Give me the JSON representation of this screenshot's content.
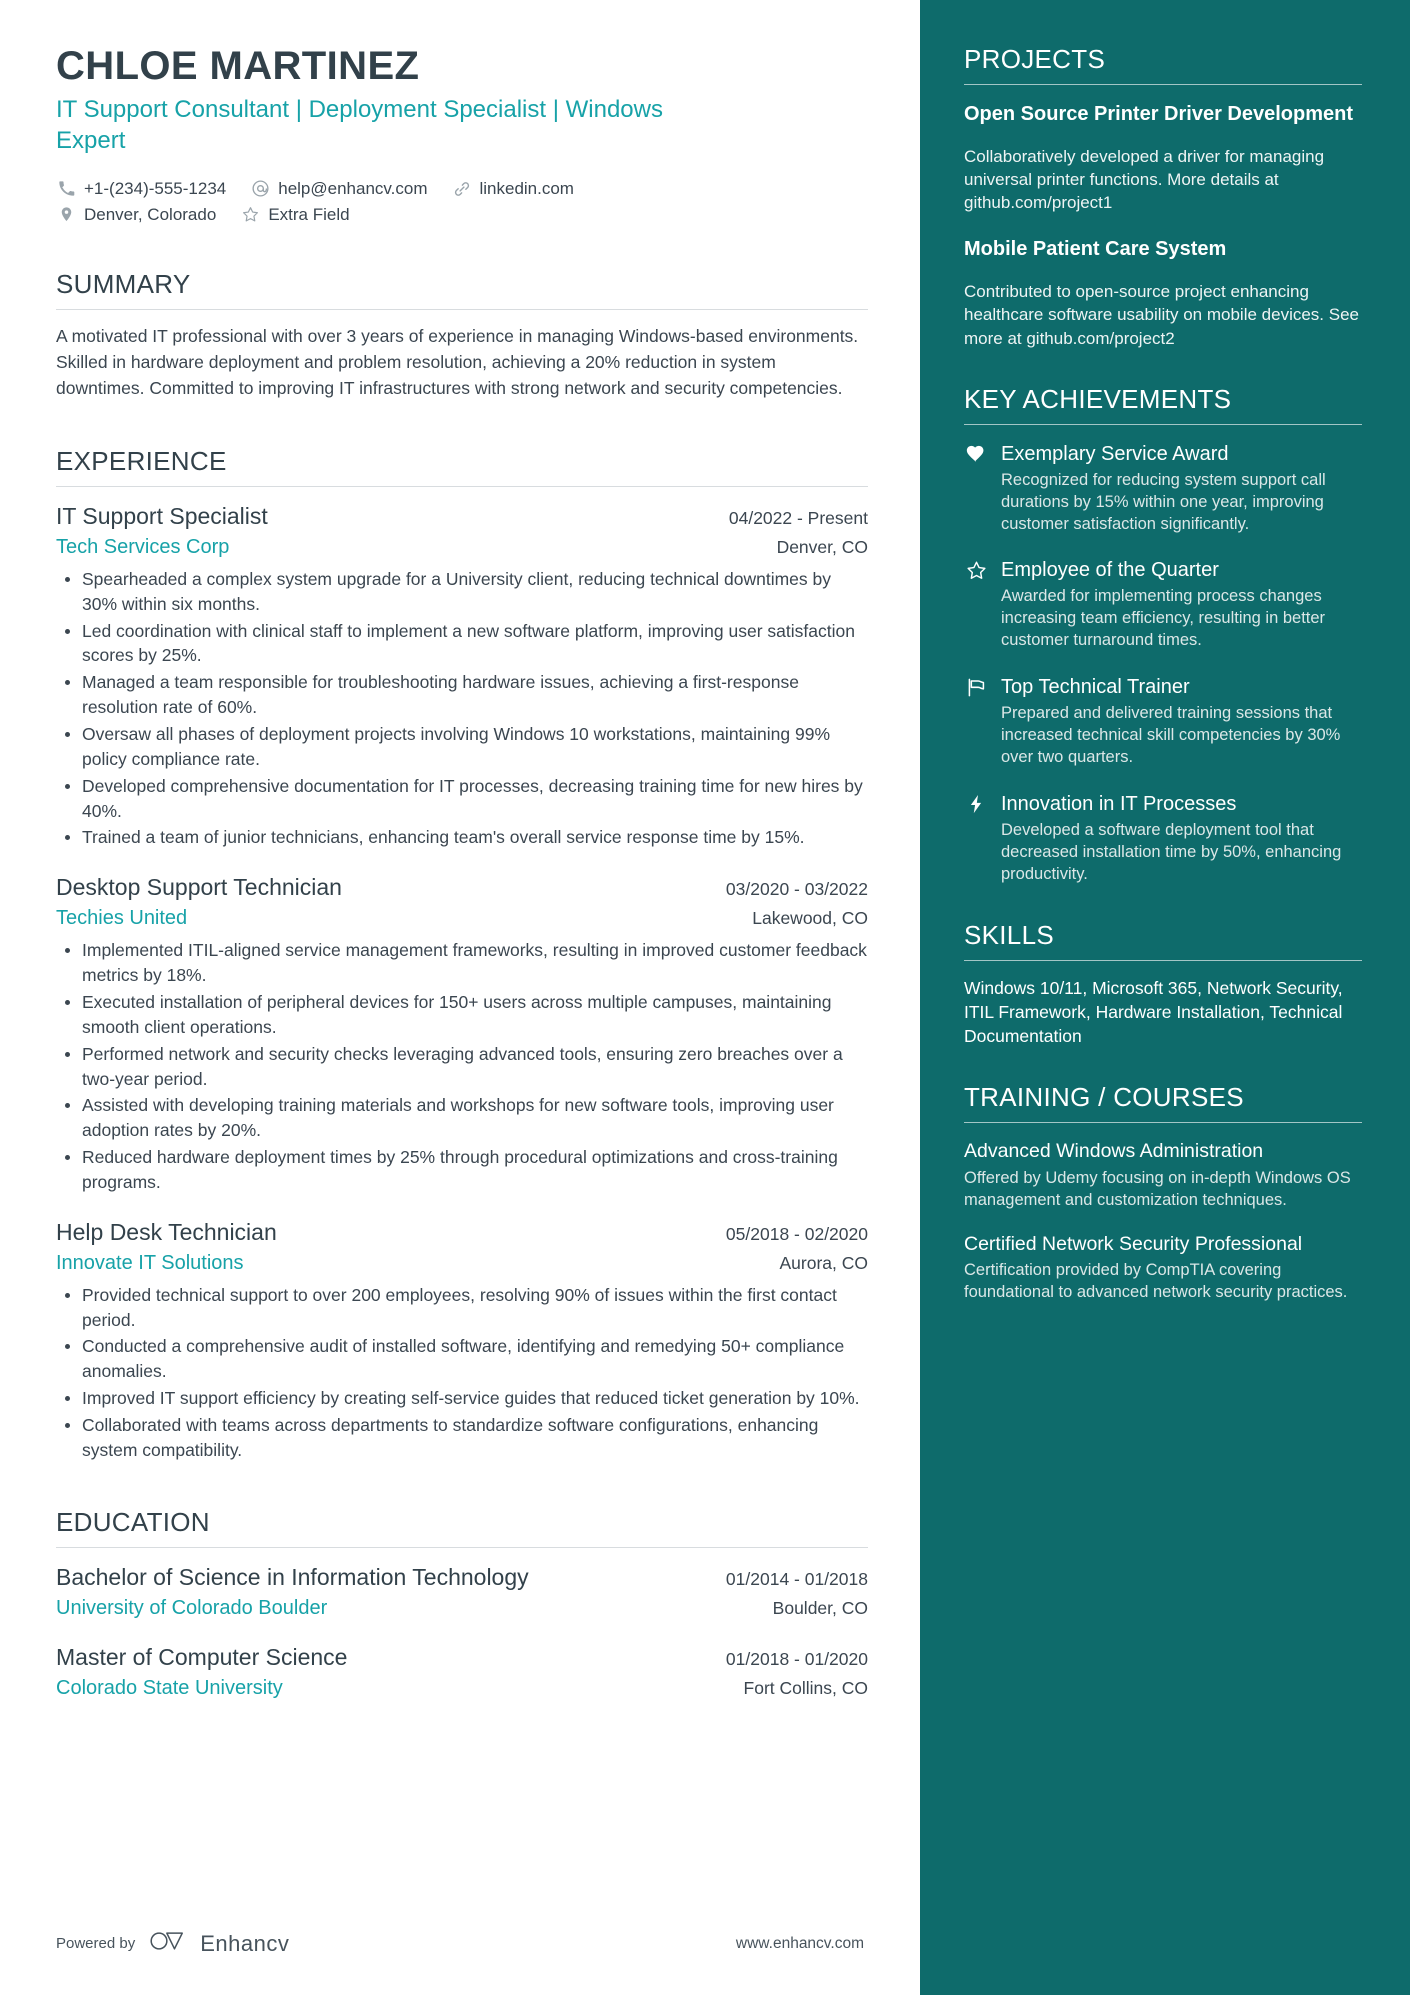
{
  "theme": {
    "accent_teal": "#17a2a8",
    "sidebar_bg": "#0e6b6b",
    "heading_dark": "#32414a",
    "body_text": "#3b4650"
  },
  "header": {
    "name": "CHLOE MARTINEZ",
    "headline": "IT Support Consultant | Deployment Specialist | Windows Expert",
    "contact_line_1": [
      {
        "icon": "phone-icon",
        "text": "+1-(234)-555-1234"
      },
      {
        "icon": "email-icon",
        "text": "help@enhancv.com"
      },
      {
        "icon": "link-icon",
        "text": "linkedin.com"
      }
    ],
    "contact_line_2": [
      {
        "icon": "location-pin-icon",
        "text": "Denver, Colorado"
      },
      {
        "icon": "star-outline-icon",
        "text": "Extra Field"
      }
    ]
  },
  "summary": {
    "title": "SUMMARY",
    "text": "A motivated IT professional with over 3 years of experience in managing Windows-based environments. Skilled in hardware deployment and problem resolution, achieving a 20% reduction in system downtimes. Committed to improving IT infrastructures with strong network and security competencies."
  },
  "experience": {
    "title": "EXPERIENCE",
    "entries": [
      {
        "role": "IT Support Specialist",
        "date": "04/2022 - Present",
        "company": "Tech Services Corp",
        "location": "Denver, CO",
        "bullets": [
          "Spearheaded a complex system upgrade for a University client, reducing technical downtimes by 30% within six months.",
          "Led coordination with clinical staff to implement a new software platform, improving user satisfaction scores by 25%.",
          "Managed a team responsible for troubleshooting hardware issues, achieving a first-response resolution rate of 60%.",
          "Oversaw all phases of deployment projects involving Windows 10 workstations, maintaining 99% policy compliance rate.",
          "Developed comprehensive documentation for IT processes, decreasing training time for new hires by 40%.",
          "Trained a team of junior technicians, enhancing team's overall service response time by 15%."
        ]
      },
      {
        "role": "Desktop Support Technician",
        "date": "03/2020 - 03/2022",
        "company": "Techies United",
        "location": "Lakewood, CO",
        "bullets": [
          "Implemented ITIL-aligned service management frameworks, resulting in improved customer feedback metrics by 18%.",
          "Executed installation of peripheral devices for 150+ users across multiple campuses, maintaining smooth client operations.",
          "Performed network and security checks leveraging advanced tools, ensuring zero breaches over a two-year period.",
          "Assisted with developing training materials and workshops for new software tools, improving user adoption rates by 20%.",
          "Reduced hardware deployment times by 25% through procedural optimizations and cross-training programs."
        ]
      },
      {
        "role": "Help Desk Technician",
        "date": "05/2018 - 02/2020",
        "company": "Innovate IT Solutions",
        "location": "Aurora, CO",
        "bullets": [
          "Provided technical support to over 200 employees, resolving 90% of issues within the first contact period.",
          "Conducted a comprehensive audit of installed software, identifying and remedying 50+ compliance anomalies.",
          "Improved IT support efficiency by creating self-service guides that reduced ticket generation by 10%.",
          "Collaborated with teams across departments to standardize software configurations, enhancing system compatibility."
        ]
      }
    ]
  },
  "education": {
    "title": "EDUCATION",
    "entries": [
      {
        "degree": "Bachelor of Science in Information Technology",
        "date": "01/2014 - 01/2018",
        "school": "University of Colorado Boulder",
        "location": "Boulder, CO"
      },
      {
        "degree": "Master of Computer Science",
        "date": "01/2018 - 01/2020",
        "school": "Colorado State University",
        "location": "Fort Collins, CO"
      }
    ]
  },
  "footer": {
    "powered_by": "Powered by",
    "brand": "Enhancv",
    "url": "www.enhancv.com"
  },
  "sidebar": {
    "projects": {
      "title": "PROJECTS",
      "items": [
        {
          "name": "Open Source Printer Driver Development",
          "description": "Collaboratively developed a driver for managing universal printer functions. More details at github.com/project1"
        },
        {
          "name": "Mobile Patient Care System",
          "description": "Contributed to open-source project enhancing healthcare software usability on mobile devices. See more at github.com/project2"
        }
      ]
    },
    "achievements": {
      "title": "KEY ACHIEVEMENTS",
      "items": [
        {
          "icon": "heart-icon",
          "name": "Exemplary Service Award",
          "description": "Recognized for reducing system support call durations by 15% within one year, improving customer satisfaction significantly."
        },
        {
          "icon": "star-outline-icon",
          "name": "Employee of the Quarter",
          "description": "Awarded for implementing process changes increasing team efficiency, resulting in better customer turnaround times."
        },
        {
          "icon": "flag-icon",
          "name": "Top Technical Trainer",
          "description": "Prepared and delivered training sessions that increased technical skill competencies by 30% over two quarters."
        },
        {
          "icon": "lightning-bolt-icon",
          "name": "Innovation in IT Processes",
          "description": "Developed a software deployment tool that decreased installation time by 50%, enhancing productivity."
        }
      ]
    },
    "skills": {
      "title": "SKILLS",
      "text": "Windows 10/11, Microsoft 365, Network Security, ITIL Framework, Hardware Installation, Technical Documentation"
    },
    "training": {
      "title": "TRAINING / COURSES",
      "items": [
        {
          "name": "Advanced Windows Administration",
          "description": "Offered by Udemy focusing on in-depth Windows OS management and customization techniques."
        },
        {
          "name": "Certified Network Security Professional",
          "description": "Certification provided by CompTIA covering foundational to advanced network security practices."
        }
      ]
    }
  }
}
